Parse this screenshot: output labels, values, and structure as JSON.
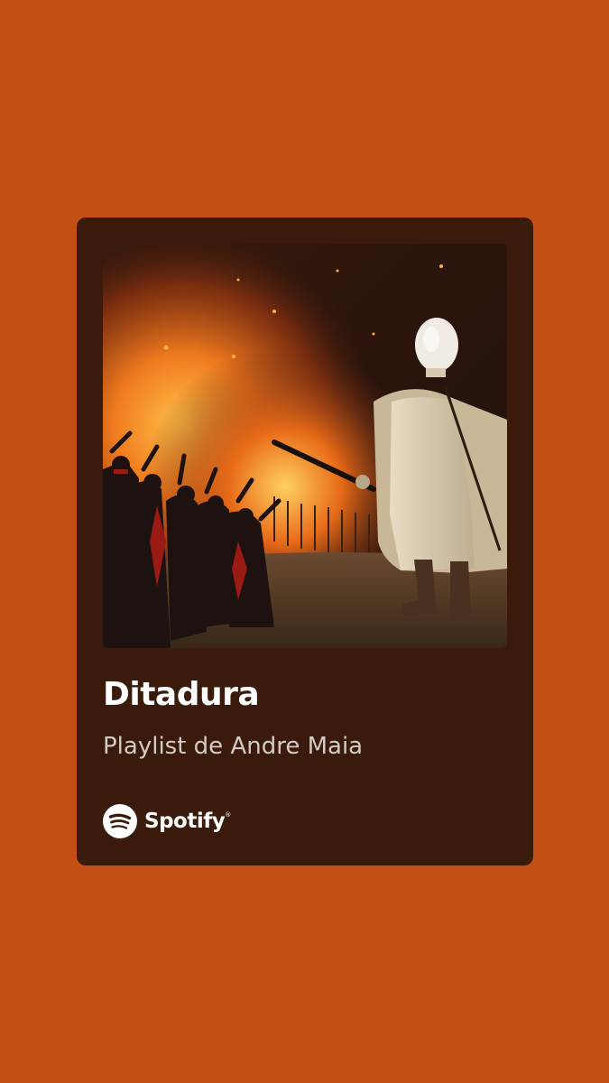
{
  "playlist": {
    "title": "Ditadura",
    "subtitle": "Playlist de Andre Maia"
  },
  "brand": {
    "name": "Spotify",
    "icon": "spotify-icon"
  },
  "colors": {
    "background": "#C44F14",
    "card": "#3A1A0A",
    "title": "#FFFFFF",
    "subtitle": "#D4CBC4"
  },
  "cover": {
    "description_icon": "album-cover-art"
  }
}
